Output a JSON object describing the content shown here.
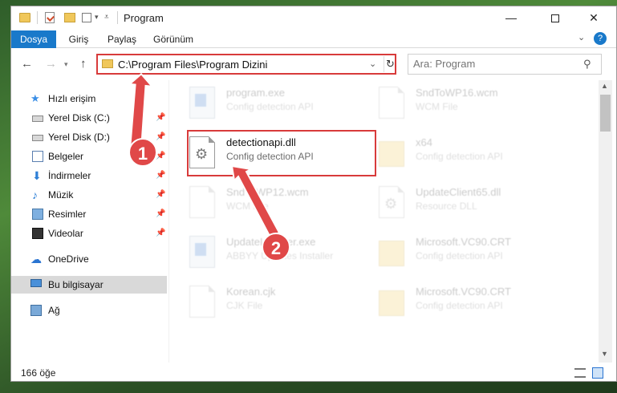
{
  "window": {
    "title": "Program",
    "minimize": "—",
    "close": "✕"
  },
  "ribbon": {
    "tabs": [
      "Dosya",
      "Giriş",
      "Paylaş",
      "Görünüm"
    ],
    "help": "?"
  },
  "address": {
    "path": "C:\\Program Files\\Program Dizini"
  },
  "search": {
    "placeholder": "Ara: Program"
  },
  "sidebar": {
    "items": [
      {
        "label": "Hızlı erişim",
        "icon": "star-icon"
      },
      {
        "label": "Yerel Disk (C:)",
        "icon": "disk-icon",
        "pinned": true
      },
      {
        "label": "Yerel Disk (D:)",
        "icon": "disk-icon",
        "pinned": true
      },
      {
        "label": "Belgeler",
        "icon": "documents-icon",
        "pinned": true
      },
      {
        "label": "İndirmeler",
        "icon": "download-icon",
        "pinned": true
      },
      {
        "label": "Müzik",
        "icon": "music-icon",
        "pinned": true
      },
      {
        "label": "Resimler",
        "icon": "pictures-icon",
        "pinned": true
      },
      {
        "label": "Videolar",
        "icon": "video-icon",
        "pinned": true
      },
      {
        "label": "OneDrive",
        "icon": "cloud-icon"
      },
      {
        "label": "Bu bilgisayar",
        "icon": "computer-icon",
        "selected": true
      },
      {
        "label": "Ağ",
        "icon": "network-icon"
      }
    ]
  },
  "files": [
    {
      "name": "program.exe",
      "type": "Config detection API",
      "icon": "exe-icon"
    },
    {
      "name": "SndToWP16.wcm",
      "type": "WCM File",
      "icon": "document-icon"
    },
    {
      "name": "detectionapi.dll",
      "type": "Config detection API",
      "icon": "dll-icon"
    },
    {
      "name": "x64",
      "type": "Config detection API",
      "icon": "folder-icon"
    },
    {
      "name": "SndToWP12.wcm",
      "type": "WCM File",
      "icon": "document-icon"
    },
    {
      "name": "UpdateClient65.dll",
      "type": "Resource DLL",
      "icon": "dll-icon"
    },
    {
      "name": "UpdateInstaller.exe",
      "type": "ABBYY Updates Installer",
      "icon": "exe-icon"
    },
    {
      "name": "Microsoft.VC90.CRT",
      "type": "Config detection API",
      "icon": "folder-icon"
    },
    {
      "name": "Korean.cjk",
      "type": "CJK File",
      "icon": "document-icon"
    },
    {
      "name": "Microsoft.VC90.CRT",
      "type": "Config detection API",
      "icon": "folder-icon"
    }
  ],
  "status": {
    "count": "166 öğe"
  },
  "annotations": {
    "badge1": "1",
    "badge2": "2",
    "color": "#e04848"
  }
}
